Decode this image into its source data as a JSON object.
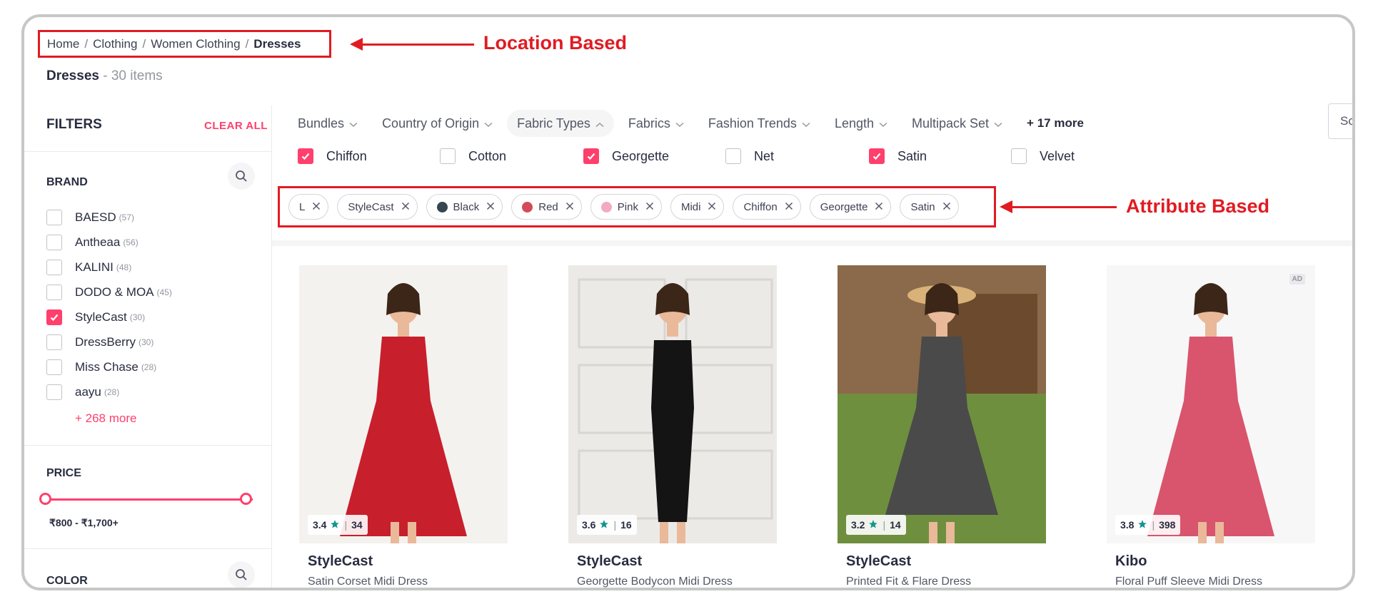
{
  "breadcrumb": {
    "items": [
      "Home",
      "Clothing",
      "Women Clothing"
    ],
    "current": "Dresses"
  },
  "callouts": {
    "location": "Location Based",
    "attribute": "Attribute Based"
  },
  "title": {
    "name": "Dresses",
    "count": " - 30 items"
  },
  "filters": {
    "heading": "FILTERS",
    "clear_all": "CLEAR ALL",
    "brand": {
      "title": "BRAND",
      "items": [
        {
          "label": "BAESD",
          "count": "(57)",
          "checked": false
        },
        {
          "label": "Antheaa",
          "count": "(56)",
          "checked": false
        },
        {
          "label": "KALINI",
          "count": "(48)",
          "checked": false
        },
        {
          "label": "DODO & MOA",
          "count": "(45)",
          "checked": false
        },
        {
          "label": "StyleCast",
          "count": "(30)",
          "checked": true
        },
        {
          "label": "DressBerry",
          "count": "(30)",
          "checked": false
        },
        {
          "label": "Miss Chase",
          "count": "(28)",
          "checked": false
        },
        {
          "label": "aayu",
          "count": "(28)",
          "checked": false
        }
      ],
      "more": "+ 268 more"
    },
    "price": {
      "title": "PRICE",
      "range": "₹800 - ₹1,700+"
    },
    "color": {
      "title": "COLOR"
    }
  },
  "filter_bar": {
    "items": [
      "Bundles",
      "Country of Origin",
      "Fabric Types",
      "Fabrics",
      "Fashion Trends",
      "Length",
      "Multipack Set"
    ],
    "active": "Fabric Types",
    "more": "+ 17 more",
    "sort_partial": "So"
  },
  "fabric_options": [
    {
      "label": "Chiffon",
      "checked": true
    },
    {
      "label": "Cotton",
      "checked": false
    },
    {
      "label": "Georgette",
      "checked": true
    },
    {
      "label": "Net",
      "checked": false
    },
    {
      "label": "Satin",
      "checked": true
    },
    {
      "label": "Velvet",
      "checked": false
    }
  ],
  "chips": [
    {
      "label": "L",
      "color": null
    },
    {
      "label": "StyleCast",
      "color": null
    },
    {
      "label": "Black",
      "color": "#36454f"
    },
    {
      "label": "Red",
      "color": "#d34b56"
    },
    {
      "label": "Pink",
      "color": "#f1a9c4"
    },
    {
      "label": "Midi",
      "color": null
    },
    {
      "label": "Chiffon",
      "color": null
    },
    {
      "label": "Georgette",
      "color": null
    },
    {
      "label": "Satin",
      "color": null
    }
  ],
  "products": [
    {
      "brand": "StyleCast",
      "name": "Satin Corset Midi Dress",
      "rating": "3.4",
      "reviews": "34",
      "dress_color": "#c81f2c",
      "bg": "#f4f2ef",
      "ad": false
    },
    {
      "brand": "StyleCast",
      "name": "Georgette Bodycon Midi Dress",
      "rating": "3.6",
      "reviews": "16",
      "dress_color": "#141414",
      "bg": "#eceae7",
      "ad": false
    },
    {
      "brand": "StyleCast",
      "name": "Printed Fit & Flare Dress",
      "rating": "3.2",
      "reviews": "14",
      "dress_color": "#4a4a4a",
      "bg": "#7a8a5a",
      "ad": false
    },
    {
      "brand": "Kibo",
      "name": "Floral Puff Sleeve Midi Dress",
      "rating": "3.8",
      "reviews": "398",
      "dress_color": "#d9546d",
      "bg": "#f7f7f7",
      "ad": true
    }
  ],
  "ad_label": "AD",
  "colors": {
    "accent": "#ff3f6c",
    "annotation": "#e11b22",
    "star": "#14958f"
  }
}
